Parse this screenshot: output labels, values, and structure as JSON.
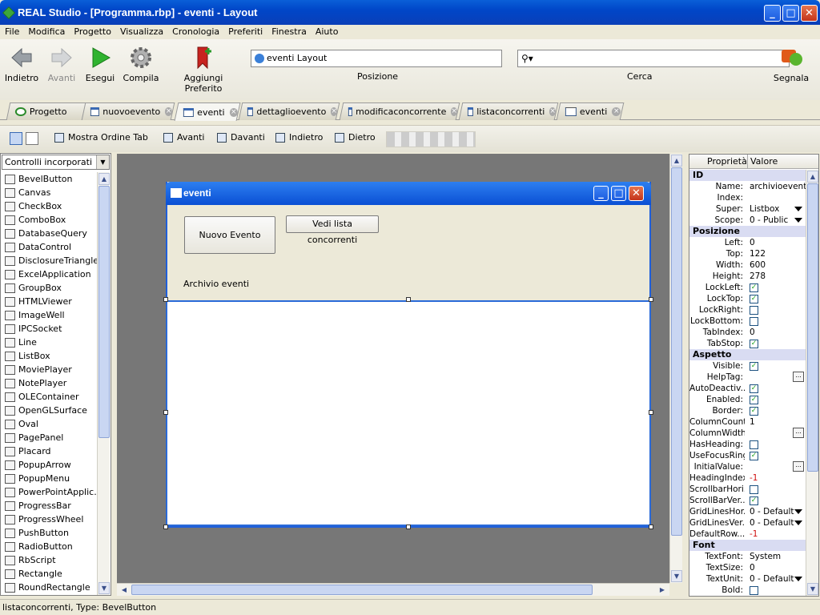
{
  "window": {
    "title": "REAL Studio - [Programma.rbp] - eventi - Layout"
  },
  "menu": [
    "File",
    "Modifica",
    "Progetto",
    "Visualizza",
    "Cronologia",
    "Preferiti",
    "Finestra",
    "Aiuto"
  ],
  "toolbar": {
    "back": "Indietro",
    "forward": "Avanti",
    "run": "Esegui",
    "build": "Compila",
    "bookmark": "Aggiungi Preferito",
    "location_value": "eventi Layout",
    "location_label": "Posizione",
    "search_label": "Cerca",
    "report": "Segnala"
  },
  "tabs": [
    {
      "label": "Progetto",
      "icon": "project-icon"
    },
    {
      "label": "nuovoevento",
      "icon": "window-icon"
    },
    {
      "label": "eventi",
      "icon": "window-icon"
    },
    {
      "label": "dettaglioevento",
      "icon": "window-icon"
    },
    {
      "label": "modificaconcorrente",
      "icon": "window-icon"
    },
    {
      "label": "listaconcorrenti",
      "icon": "window-icon"
    },
    {
      "label": "eventi",
      "icon": "code-icon"
    }
  ],
  "layoutbar": {
    "tab_order": "Mostra Ordine Tab",
    "forward": "Avanti",
    "front": "Davanti",
    "backward": "Indietro",
    "back": "Dietro"
  },
  "controls": {
    "selector": "Controlli incorporati",
    "items": [
      "BevelButton",
      "Canvas",
      "CheckBox",
      "ComboBox",
      "DatabaseQuery",
      "DataControl",
      "DisclosureTriangle",
      "ExcelApplication",
      "GroupBox",
      "HTMLViewer",
      "ImageWell",
      "IPCSocket",
      "Line",
      "ListBox",
      "MoviePlayer",
      "NotePlayer",
      "OLEContainer",
      "OpenGLSurface",
      "Oval",
      "PagePanel",
      "Placard",
      "PopupArrow",
      "PopupMenu",
      "PowerPointApplic...",
      "ProgressBar",
      "ProgressWheel",
      "PushButton",
      "RadioButton",
      "RbScript",
      "Rectangle",
      "RoundRectangle"
    ]
  },
  "design": {
    "window_title": "eventi",
    "btn_new": "Nuovo Evento",
    "btn_list": "Vedi lista concorrenti",
    "label": "Archivio eventi"
  },
  "properties": {
    "h_name": "Proprietà",
    "h_value": "Valore",
    "rows": [
      {
        "s": "ID"
      },
      {
        "n": "Name:",
        "v": "archivioeventi"
      },
      {
        "n": "Index:",
        "v": ""
      },
      {
        "n": "Super:",
        "v": "Listbox",
        "dd": true
      },
      {
        "n": "Scope:",
        "v": "0 - Public",
        "dd": true
      },
      {
        "s": "Posizione"
      },
      {
        "n": "Left:",
        "v": "0"
      },
      {
        "n": "Top:",
        "v": "122"
      },
      {
        "n": "Width:",
        "v": "600"
      },
      {
        "n": "Height:",
        "v": "278"
      },
      {
        "n": "LockLeft:",
        "c": true
      },
      {
        "n": "LockTop:",
        "c": true
      },
      {
        "n": "LockRight:",
        "c": false
      },
      {
        "n": "LockBottom:",
        "c": false
      },
      {
        "n": "TabIndex:",
        "v": "0"
      },
      {
        "n": "TabStop:",
        "c": true
      },
      {
        "s": "Aspetto"
      },
      {
        "n": "Visible:",
        "c": true
      },
      {
        "n": "HelpTag:",
        "v": "",
        "dots": true
      },
      {
        "n": "AutoDeactiv...",
        "c": true
      },
      {
        "n": "Enabled:",
        "c": true
      },
      {
        "n": "Border:",
        "c": true
      },
      {
        "n": "ColumnCount:",
        "v": "1"
      },
      {
        "n": "ColumnWidths:",
        "v": "",
        "dots": true
      },
      {
        "n": "HasHeading:",
        "c": false
      },
      {
        "n": "UseFocusRing:",
        "c": true
      },
      {
        "n": "InitialValue:",
        "v": "",
        "dots": true
      },
      {
        "n": "HeadingIndex:",
        "v": "-1",
        "red": true
      },
      {
        "n": "ScrollbarHori...",
        "c": false
      },
      {
        "n": "ScrollBarVer...",
        "c": true
      },
      {
        "n": "GridLinesHor...",
        "v": "0 - Default",
        "dd": true
      },
      {
        "n": "GridLinesVer...",
        "v": "0 - Default",
        "dd": true
      },
      {
        "n": "DefaultRow...",
        "v": "-1",
        "red": true
      },
      {
        "s": "Font"
      },
      {
        "n": "TextFont:",
        "v": "System"
      },
      {
        "n": "TextSize:",
        "v": "0"
      },
      {
        "n": "TextUnit:",
        "v": "0 - Default",
        "dd": true
      },
      {
        "n": "Bold:",
        "c": false
      }
    ]
  },
  "status": "listaconcorrenti, Type: BevelButton",
  "colors": {
    "titlebar": "#0046c8",
    "canvas": "#777777",
    "section": "#d9dcf2"
  }
}
